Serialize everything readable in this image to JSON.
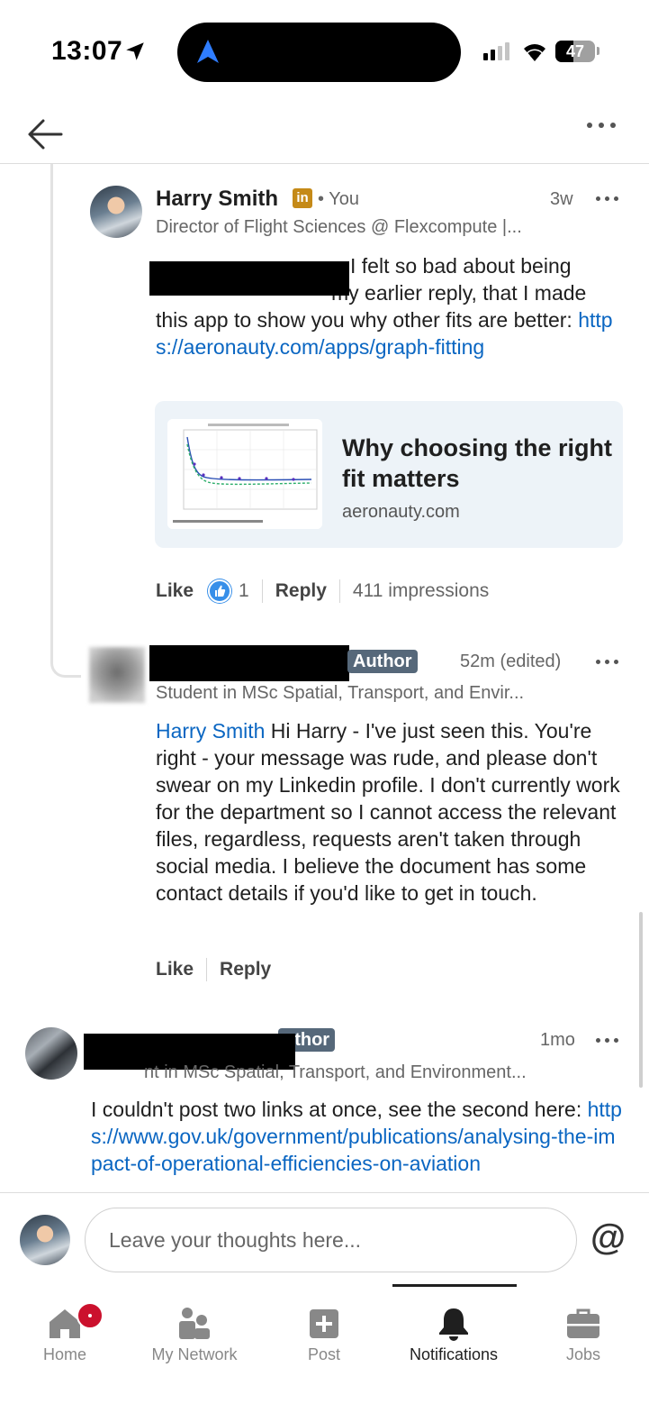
{
  "status_bar": {
    "time": "13:07",
    "battery": "47"
  },
  "header": {
    "back_icon": "arrow-left-icon",
    "more_icon": "more-horizontal-icon"
  },
  "comment_1": {
    "author_name": "Harry Smith",
    "badge": "in",
    "relation": "• You",
    "time": "3w",
    "headline": "Director of Flight Sciences @ Flexcompute |...",
    "text_part1": "I felt so bad about being",
    "text_part2": "my earlier reply, that I made this app to show you why other fits are better: ",
    "link": "https://aeronauty.com/apps/graph-fitting",
    "card_title": "Why choosing the right fit matters",
    "card_domain": "aeronauty.com",
    "like_label": "Like",
    "reaction_count": "1",
    "reply_label": "Reply",
    "impressions": "411 impressions"
  },
  "comment_2": {
    "author_badge": "Author",
    "time": "52m (edited)",
    "headline": "Student in MSc Spatial, Transport, and Envir...",
    "mention": "Harry Smith",
    "text": " Hi Harry - I've just seen this. You're right - your message was rude, and please don't swear on my Linkedin profile. I don't currently work for the department so I cannot access the relevant files, regardless, requests aren't taken through social media. I believe the document has some contact details if you'd like to get in touch.",
    "like_label": "Like",
    "reply_label": "Reply"
  },
  "comment_3": {
    "author_badge": "uthor",
    "time": "1mo",
    "headline": "nt in MSc Spatial, Transport, and Environment...",
    "text": "I couldn't post two links at once, see the second here: ",
    "link": "https://www.gov.uk/government/publications/analysing-the-impact-of-operational-efficiencies-on-aviation"
  },
  "composer": {
    "placeholder": "Leave your thoughts here...",
    "at_symbol": "@"
  },
  "bottom_nav": {
    "items": [
      {
        "label": "Home",
        "icon": "home-icon"
      },
      {
        "label": "My Network",
        "icon": "network-icon"
      },
      {
        "label": "Post",
        "icon": "plus-square-icon"
      },
      {
        "label": "Notifications",
        "icon": "bell-icon"
      },
      {
        "label": "Jobs",
        "icon": "briefcase-icon"
      }
    ],
    "active": "Notifications"
  },
  "colors": {
    "link": "#0a66c2",
    "author_badge": "#56687a",
    "notification_dot": "#cb112d",
    "card_bg": "#edf3f8"
  }
}
